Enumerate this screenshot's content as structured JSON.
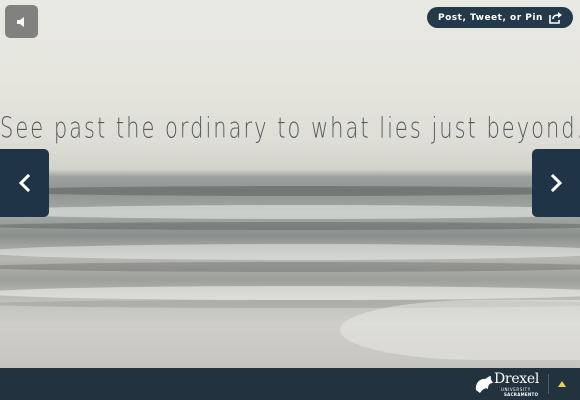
{
  "slide": {
    "tagline": "See past the ordinary to what lies just beyond..."
  },
  "controls": {
    "sound_icon": "speaker-icon",
    "share_label": "Post, Tweet, or Pin",
    "share_icon": "share-icon",
    "prev_icon": "chevron-left-icon",
    "next_icon": "chevron-right-icon"
  },
  "footer": {
    "logo_name": "Drexel",
    "logo_sub": "UNIVERSITY",
    "logo_sub2": "SACRAMENTO",
    "toggle_icon": "triangle-up-icon"
  },
  "colors": {
    "nav_bg": "#1f3446",
    "footer_bg": "#22333f",
    "toggle": "#e8d24a"
  }
}
